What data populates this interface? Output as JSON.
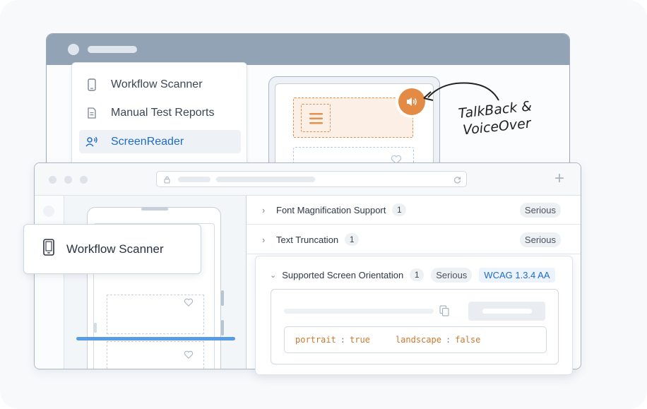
{
  "menu": {
    "items": [
      {
        "label": "Workflow Scanner",
        "icon": "phone-icon",
        "active": false
      },
      {
        "label": "Manual Test Reports",
        "icon": "document-icon",
        "active": false
      },
      {
        "label": "ScreenReader",
        "icon": "screen-reader-icon",
        "active": true
      }
    ]
  },
  "annotation": {
    "line1": "TalkBack &",
    "line2": "VoiceOver"
  },
  "floating_card": {
    "label": "Workflow Scanner",
    "icon": "phone-icon"
  },
  "issues": [
    {
      "title": "Font Magnification Support",
      "count": "1",
      "severity": "Serious"
    },
    {
      "title": "Text Truncation",
      "count": "1",
      "severity": "Serious"
    }
  ],
  "expanded_issue": {
    "title": "Supported Screen Orientation",
    "count": "1",
    "severity": "Serious",
    "wcag": "WCAG 1.3.4 AA",
    "code": {
      "k1": "portrait",
      "v1": "true",
      "k2": "landscape",
      "v2": "false",
      "sep": ":"
    }
  },
  "colors": {
    "accent": "#1e6bc7",
    "orange": "#e38b45",
    "highlight_line": "#5a9be6"
  }
}
